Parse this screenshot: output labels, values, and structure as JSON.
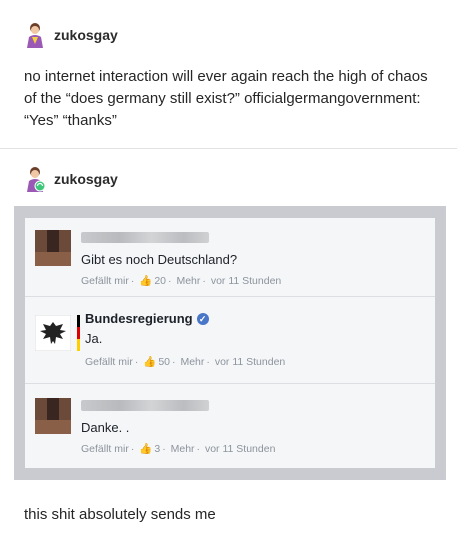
{
  "post1": {
    "username": "zukosgay",
    "text": "no internet interaction will ever again reach the high of chaos of the “does germany still exist?” officialgermangovernment: “Yes” “thanks”"
  },
  "post2": {
    "username": "zukosgay"
  },
  "facebook": {
    "comments": [
      {
        "name": "",
        "text": "Gibt es noch Deutschland?",
        "like": "Gefällt mir",
        "like_count": "20",
        "more": "Mehr",
        "time": "vor 11 Stunden"
      },
      {
        "name": "Bundesregierung",
        "text": "Ja.",
        "like": "Gefällt mir",
        "like_count": "50",
        "more": "Mehr",
        "time": "vor 11 Stunden"
      },
      {
        "name": "",
        "text": "Danke. .",
        "like": "Gefällt mir",
        "like_count": "3",
        "more": "Mehr",
        "time": "vor 11 Stunden"
      }
    ]
  },
  "caption": "this shit absolutely sends me",
  "colors": {
    "verified": "#4a76c8",
    "meta": "#8d949e"
  }
}
